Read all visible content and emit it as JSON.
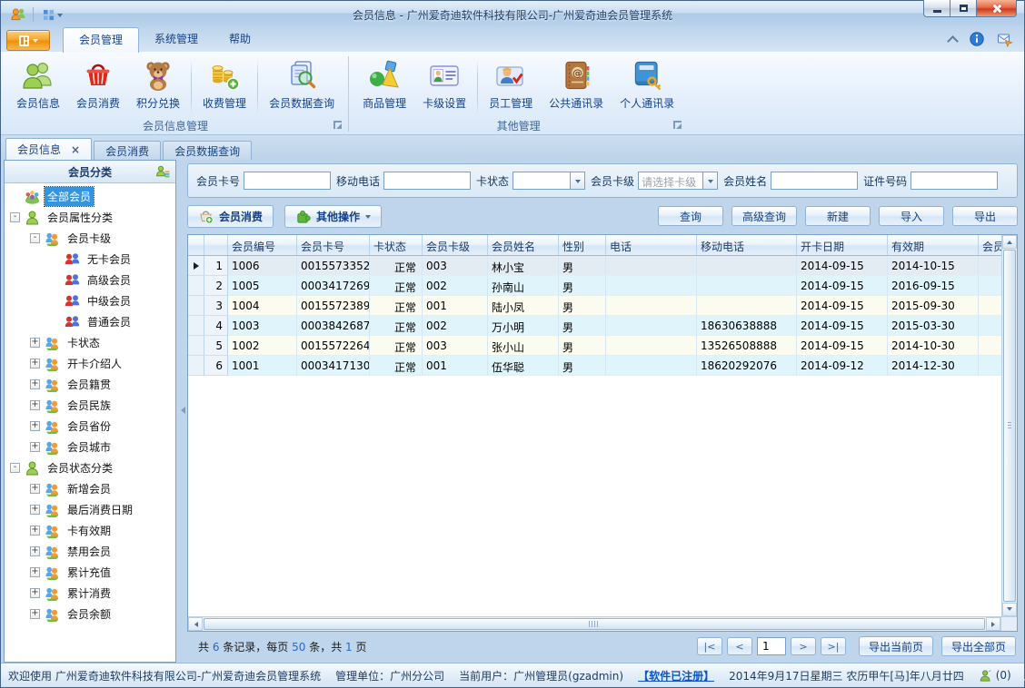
{
  "window": {
    "title": "会员信息 - 广州爱奇迪软件科技有限公司-广州爱奇迪会员管理系统"
  },
  "ribbon": {
    "tabs": [
      {
        "label": "会员管理",
        "active": true
      },
      {
        "label": "系统管理",
        "active": false
      },
      {
        "label": "帮助",
        "active": false
      }
    ],
    "groups": [
      {
        "label": "会员信息管理",
        "buttons": [
          {
            "label": "会员信息",
            "icon": "members-icon"
          },
          {
            "label": "会员消费",
            "icon": "basket-icon"
          },
          {
            "label": "积分兑换",
            "icon": "teddy-bear-icon"
          },
          {
            "label": "收费管理",
            "icon": "coins-icon"
          },
          {
            "label": "会员数据查询",
            "icon": "member-search-icon"
          }
        ]
      },
      {
        "label": "其他管理",
        "buttons": [
          {
            "label": "商品管理",
            "icon": "shapes-icon"
          },
          {
            "label": "卡级设置",
            "icon": "card-level-icon"
          },
          {
            "label": "员工管理",
            "icon": "employee-icon"
          },
          {
            "label": "公共通讯录",
            "icon": "public-contacts-icon"
          },
          {
            "label": "个人通讯录",
            "icon": "personal-contacts-icon"
          }
        ]
      }
    ]
  },
  "doc_tabs": [
    {
      "label": "会员信息",
      "active": true,
      "closable": true
    },
    {
      "label": "会员消费",
      "active": false,
      "closable": false
    },
    {
      "label": "会员数据查询",
      "active": false,
      "closable": false
    }
  ],
  "sidebar": {
    "header": "会员分类",
    "tree": [
      {
        "label": "全部会员",
        "level": 0,
        "icon": "all-members-icon",
        "expander": "",
        "selected": true
      },
      {
        "label": "会员属性分类",
        "level": 0,
        "icon": "member-green-icon",
        "expander": "-"
      },
      {
        "label": "会员卡级",
        "level": 1,
        "icon": "member-duo-icon",
        "expander": "-"
      },
      {
        "label": "无卡会员",
        "level": 2,
        "icon": "member-pair-icon",
        "expander": ""
      },
      {
        "label": "高级会员",
        "level": 2,
        "icon": "member-pair-icon",
        "expander": ""
      },
      {
        "label": "中级会员",
        "level": 2,
        "icon": "member-pair-icon",
        "expander": ""
      },
      {
        "label": "普通会员",
        "level": 2,
        "icon": "member-pair-icon",
        "expander": ""
      },
      {
        "label": "卡状态",
        "level": 1,
        "icon": "member-duo-icon",
        "expander": "+"
      },
      {
        "label": "开卡介绍人",
        "level": 1,
        "icon": "member-duo-icon",
        "expander": "+"
      },
      {
        "label": "会员籍贯",
        "level": 1,
        "icon": "member-duo-icon",
        "expander": "+"
      },
      {
        "label": "会员民族",
        "level": 1,
        "icon": "member-duo-icon",
        "expander": "+"
      },
      {
        "label": "会员省份",
        "level": 1,
        "icon": "member-duo-icon",
        "expander": "+"
      },
      {
        "label": "会员城市",
        "level": 1,
        "icon": "member-duo-icon",
        "expander": "+"
      },
      {
        "label": "会员状态分类",
        "level": 0,
        "icon": "member-green-icon",
        "expander": "-"
      },
      {
        "label": "新增会员",
        "level": 1,
        "icon": "member-duo-icon",
        "expander": "+"
      },
      {
        "label": "最后消费日期",
        "level": 1,
        "icon": "member-duo-icon",
        "expander": "+"
      },
      {
        "label": "卡有效期",
        "level": 1,
        "icon": "member-duo-icon",
        "expander": "+"
      },
      {
        "label": "禁用会员",
        "level": 1,
        "icon": "member-duo-icon",
        "expander": "+"
      },
      {
        "label": "累计充值",
        "level": 1,
        "icon": "member-duo-icon",
        "expander": "+"
      },
      {
        "label": "累计消费",
        "level": 1,
        "icon": "member-duo-icon",
        "expander": "+"
      },
      {
        "label": "会员余额",
        "level": 1,
        "icon": "member-duo-icon",
        "expander": "+"
      }
    ]
  },
  "filters": {
    "fields": [
      {
        "label": "会员卡号",
        "type": "input",
        "value": ""
      },
      {
        "label": "移动电话",
        "type": "input",
        "value": ""
      },
      {
        "label": "卡状态",
        "type": "select",
        "value": "",
        "placeholder": false
      },
      {
        "label": "会员卡级",
        "type": "select",
        "value": "请选择卡级",
        "placeholder": true
      },
      {
        "label": "会员姓名",
        "type": "input",
        "value": ""
      },
      {
        "label": "证件号码",
        "type": "input",
        "value": ""
      }
    ]
  },
  "toolbar": {
    "consume": "会员消费",
    "other": "其他操作",
    "actions": [
      "查询",
      "高级查询",
      "新建",
      "导入",
      "导出"
    ]
  },
  "grid": {
    "columns": [
      "会员编号",
      "会员卡号",
      "卡状态",
      "会员卡级",
      "会员姓名",
      "性别",
      "电话",
      "移动电话",
      "开卡日期",
      "有效期",
      "会员"
    ],
    "rows": [
      {
        "num": "1",
        "selected": true,
        "cells": [
          "1006",
          "0015573352",
          "正常",
          "003",
          "林小宝",
          "男",
          "",
          "",
          "2014-09-15",
          "2014-10-15",
          ""
        ]
      },
      {
        "num": "2",
        "selected": false,
        "cells": [
          "1005",
          "0003417269",
          "正常",
          "002",
          "孙南山",
          "男",
          "",
          "",
          "2014-09-15",
          "2016-09-15",
          ""
        ]
      },
      {
        "num": "3",
        "selected": false,
        "cells": [
          "1004",
          "0015572389",
          "正常",
          "001",
          "陆小凤",
          "男",
          "",
          "",
          "2014-09-15",
          "2015-09-30",
          ""
        ]
      },
      {
        "num": "4",
        "selected": false,
        "cells": [
          "1003",
          "0003842687",
          "正常",
          "002",
          "万小明",
          "男",
          "",
          "18630638888",
          "2014-09-15",
          "2015-03-30",
          ""
        ]
      },
      {
        "num": "5",
        "selected": false,
        "cells": [
          "1002",
          "0015572264",
          "正常",
          "003",
          "张小山",
          "男",
          "",
          "13526508888",
          "2014-09-15",
          "2014-10-30",
          ""
        ]
      },
      {
        "num": "6",
        "selected": false,
        "cells": [
          "1001",
          "0003417130",
          "正常",
          "001",
          "伍华聪",
          "男",
          "",
          "18620292076",
          "2014-09-12",
          "2014-12-30",
          ""
        ]
      }
    ]
  },
  "footer": {
    "summary": [
      [
        "共 ",
        false
      ],
      [
        "6",
        true
      ],
      [
        " 条记录，每页 ",
        false
      ],
      [
        "50",
        true
      ],
      [
        " 条，共 ",
        false
      ],
      [
        "1",
        true
      ],
      [
        " 页",
        false
      ]
    ],
    "pager": {
      "first": "|<",
      "prev": "<",
      "page": "1",
      "next": ">",
      "last": ">|"
    },
    "export_current": "导出当前页",
    "export_all": "导出全部页"
  },
  "statusbar": {
    "welcome": "欢迎使用 广州爱奇迪软件科技有限公司-广州爱奇迪会员管理系统",
    "org": "管理单位：广州分公司",
    "user": "当前用户：广州管理员(gzadmin)",
    "registered": "【软件已注册】",
    "datetime": "2014年9月17日星期三 农历甲午[马]年八月廿四",
    "online": "(0)"
  }
}
